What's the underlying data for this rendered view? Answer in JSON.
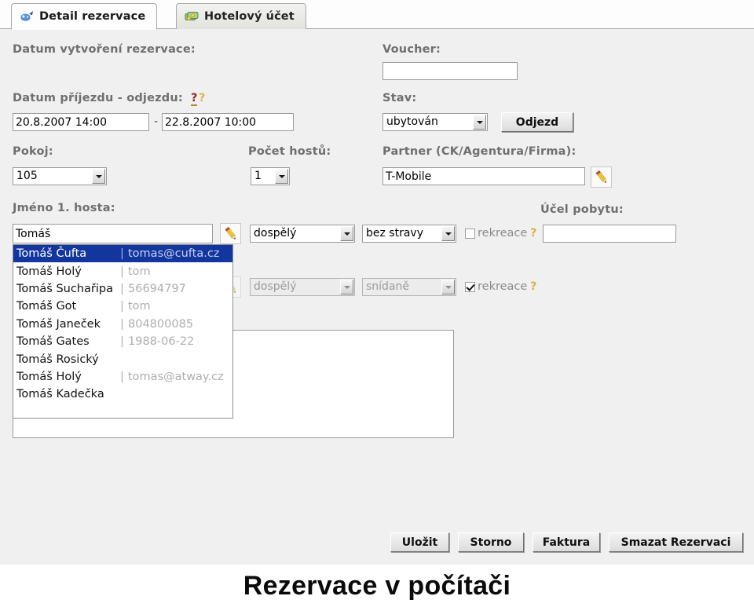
{
  "window": {
    "background_color": "#f0f0f0"
  },
  "tabs": [
    {
      "label": "Detail rezervace",
      "icon": "reservation-pin-icon",
      "active": true
    },
    {
      "label": "Hotelový účet",
      "icon": "money-bills-icon",
      "active": false
    }
  ],
  "form": {
    "created_label": "Datum vytvoření rezervace:",
    "voucher_label": "Voucher:",
    "voucher_value": "",
    "voucher_placeholder": "",
    "dates_label": "Datum příjezdu - odjezdu:",
    "dates_help_primary": "?",
    "dates_help_secondary": "?",
    "arrival_value": "20.8.2007 14:00",
    "date_separator": "-",
    "departure_value": "22.8.2007 10:00",
    "state_label": "Stav:",
    "state_value": "ubytován",
    "departure_button": "Odjezd",
    "room_label": "Pokoj:",
    "room_value": "105",
    "guests_label": "Počet hostů:",
    "guests_value": "1",
    "partner_label": "Partner (CK/Agentura/Firma):",
    "partner_value": "T-Mobile",
    "partner_edit_icon": "pencil-icon",
    "guest1_label": "Jméno 1. hosta:",
    "purpose_label": "Účel pobytu:",
    "purpose_value": "",
    "note_value": ""
  },
  "guest_rows": [
    {
      "name": "Tomáš",
      "edit_icon": "pencil-icon",
      "age_category": "dospělý",
      "board": "bez stravy",
      "recreation_label": "rekreace",
      "recreation_checked": false,
      "recreation_help": "?",
      "disabled": false
    },
    {
      "name": "",
      "edit_icon": "pencil-icon",
      "age_category": "dospělý",
      "board": "snídaně",
      "recreation_label": "rekreace",
      "recreation_checked": true,
      "recreation_help": "?",
      "disabled": true
    }
  ],
  "autocomplete": {
    "visible": true,
    "highlight_color": "#12359e",
    "items": [
      {
        "name": "Tomáš Čufta",
        "separator": "|",
        "detail": "tomas@cufta.cz",
        "selected": true
      },
      {
        "name": "Tomáš Holý",
        "separator": "|",
        "detail": "tom",
        "selected": false
      },
      {
        "name": "Tomáš Suchařipa",
        "separator": "|",
        "detail": "56694797",
        "selected": false
      },
      {
        "name": "Tomáš Got",
        "separator": "|",
        "detail": "tom",
        "selected": false
      },
      {
        "name": "Tomáš Janeček",
        "separator": "|",
        "detail": "804800085",
        "selected": false
      },
      {
        "name": "Tomáš Gates",
        "separator": "|",
        "detail": "1988-06-22",
        "selected": false
      },
      {
        "name": "Tomáš Rosický",
        "separator": "",
        "detail": "",
        "selected": false
      },
      {
        "name": "Tomáš Holý",
        "separator": "|",
        "detail": "tomas@atway.cz",
        "selected": false
      },
      {
        "name": "Tomáš Kadečka",
        "separator": "",
        "detail": "",
        "selected": false
      }
    ]
  },
  "footer_buttons": [
    {
      "label": "Uložit"
    },
    {
      "label": "Storno"
    },
    {
      "label": "Faktura"
    },
    {
      "label": "Smazat Rezervaci"
    }
  ],
  "caption": {
    "text": "Rezervace v počítači"
  }
}
